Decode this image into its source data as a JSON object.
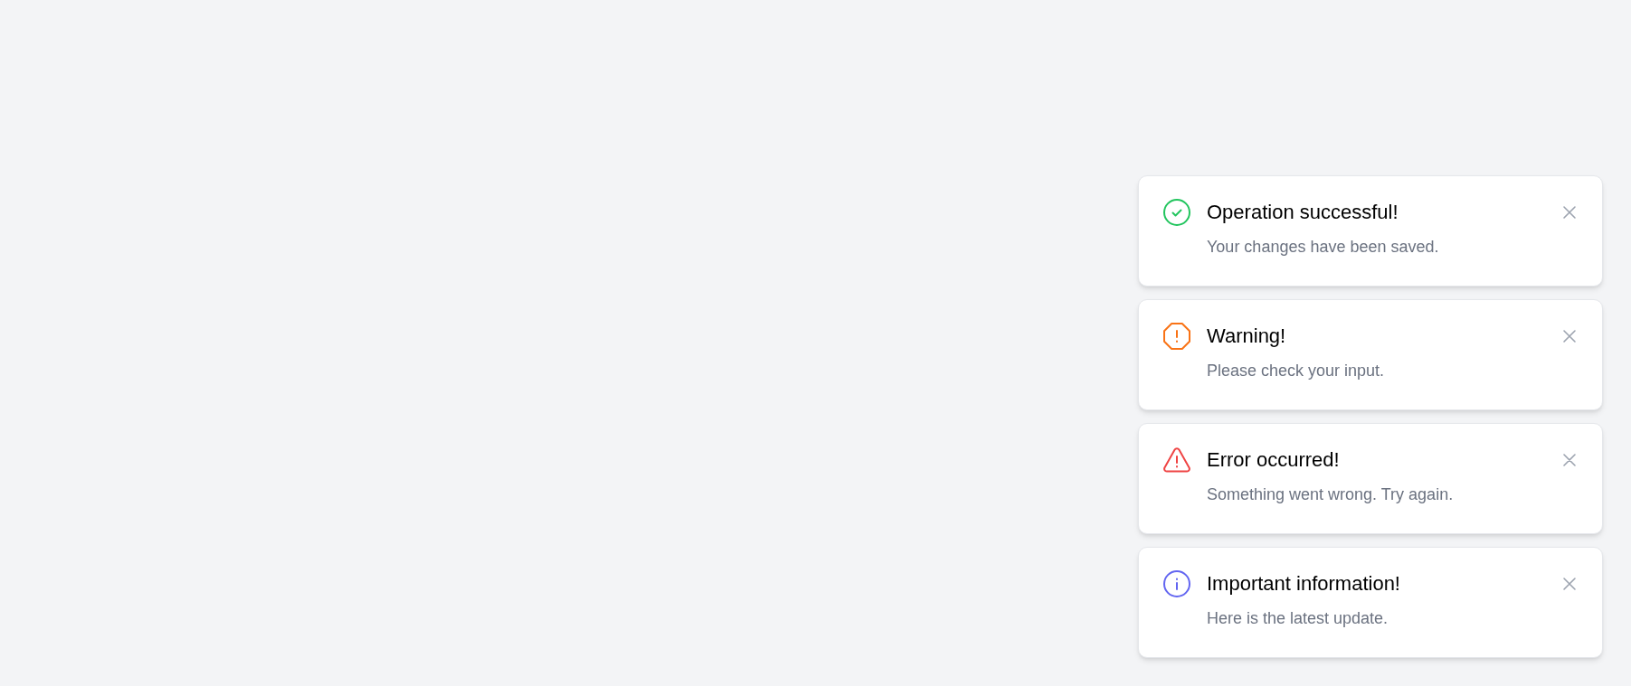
{
  "toasts": [
    {
      "kind": "success",
      "title": "Operation successful!",
      "message": "Your changes have been saved."
    },
    {
      "kind": "warning",
      "title": "Warning!",
      "message": "Please check your input."
    },
    {
      "kind": "error",
      "title": "Error occurred!",
      "message": "Something went wrong. Try again."
    },
    {
      "kind": "info",
      "title": "Important information!",
      "message": "Here is the latest update."
    }
  ]
}
